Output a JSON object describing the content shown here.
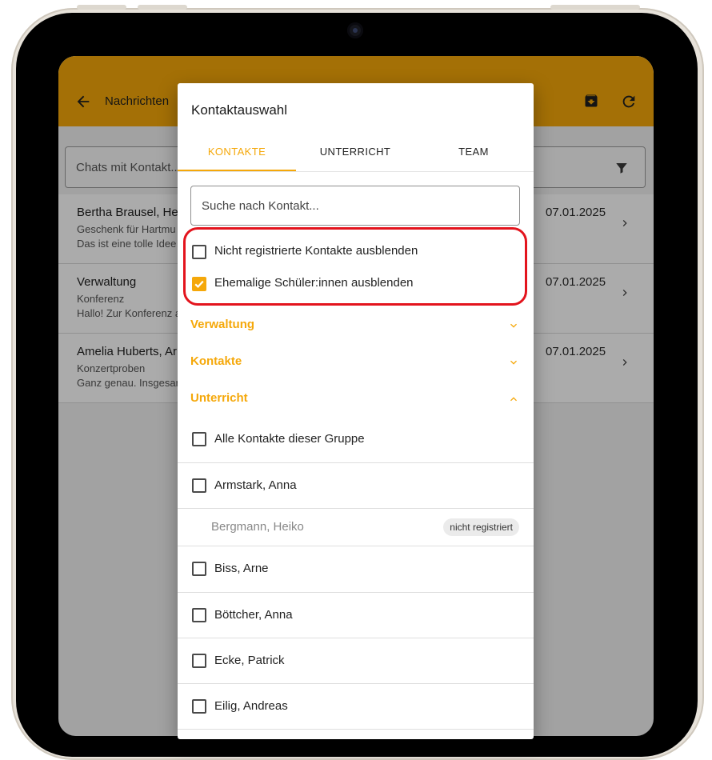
{
  "colors": {
    "accent": "#f5a80a",
    "highlight": "#e3141d",
    "overlay": "rgba(0,0,0,0.33)"
  },
  "app": {
    "back_icon": "arrow-left-icon",
    "title": "Nachrichten",
    "actions": [
      "archive-icon",
      "refresh-icon"
    ]
  },
  "chat_search": {
    "placeholder": "Chats mit Kontakt...",
    "icon": "filter-icon"
  },
  "chats": [
    {
      "name": "Bertha Brausel, Hei",
      "subject": "Geschenk für Hartmu",
      "preview": "Das ist eine tolle Idee",
      "date": "07.01.2025"
    },
    {
      "name": "Verwaltung",
      "subject": "Konferenz",
      "preview": "Hallo! Zur Konferenz a",
      "date": "07.01.2025"
    },
    {
      "name": "Amelia Huberts, Ar",
      "subject": "Konzertproben",
      "preview": "Ganz genau. Insgesar",
      "date": "07.01.2025"
    }
  ],
  "dialog": {
    "title": "Kontaktauswahl",
    "tabs": [
      {
        "label": "KONTAKTE",
        "active": true
      },
      {
        "label": "UNTERRICHT",
        "active": false
      },
      {
        "label": "TEAM",
        "active": false
      }
    ],
    "search_placeholder": "Suche nach Kontakt...",
    "options": [
      {
        "label": "Nicht registrierte Kontakte ausblenden",
        "checked": false
      },
      {
        "label": "Ehemalige Schüler:innen ausblenden",
        "checked": true
      }
    ],
    "groups": [
      {
        "label": "Verwaltung",
        "expanded": false
      },
      {
        "label": "Kontakte",
        "expanded": false
      },
      {
        "label": "Unterricht",
        "expanded": true
      }
    ],
    "contacts": [
      {
        "label": "Alle Kontakte dieser Gruppe",
        "checked": false,
        "registered": true
      },
      {
        "label": "Armstark, Anna",
        "checked": false,
        "registered": true
      },
      {
        "label": "Bergmann, Heiko",
        "registered": false,
        "badge": "nicht registriert"
      },
      {
        "label": "Biss, Arne",
        "checked": false,
        "registered": true
      },
      {
        "label": "Böttcher, Anna",
        "checked": false,
        "registered": true
      },
      {
        "label": "Ecke, Patrick",
        "checked": false,
        "registered": true
      },
      {
        "label": "Eilig, Andreas",
        "checked": false,
        "registered": true
      }
    ]
  }
}
